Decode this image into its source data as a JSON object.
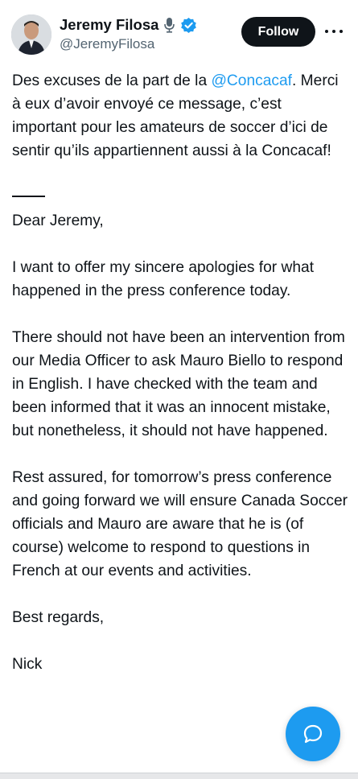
{
  "author": {
    "display_name": "Jeremy Filosa",
    "handle": "@JeremyFilosa",
    "badges": [
      "microphone-icon",
      "verified-icon"
    ],
    "verified_color": "#1d9bf0"
  },
  "actions": {
    "follow_label": "Follow",
    "more_icon": "more-horizontal-icon"
  },
  "tweet": {
    "intro_before": "Des excuses de la part de la ",
    "intro_mention": "@Concacaf",
    "intro_after": ". Merci à eux d’avoir envoyé ce message, c’est important pour les amateurs de soccer d’ici de sentir qu’ils appartiennent aussi à la Concacaf!",
    "greeting": "Dear Jeremy,",
    "paragraph_1": "I want to offer my sincere apologies for what happened in the press conference today.",
    "paragraph_2": "There should not have been an intervention from our Media Officer to ask Mauro Biello to respond in English. I have checked with the team and been informed that it was an innocent mistake, but nonetheless, it should not have happened.",
    "paragraph_3": "Rest assured, for tomorrow’s press conference and going forward we will ensure Canada Soccer officials and Mauro are aware that he is (of course) welcome to respond to questions in French at our events and activities.",
    "closing": "Best regards,",
    "signature": "Nick"
  },
  "fab": {
    "icon": "message-bubble-icon",
    "color": "#1d9bf0"
  }
}
